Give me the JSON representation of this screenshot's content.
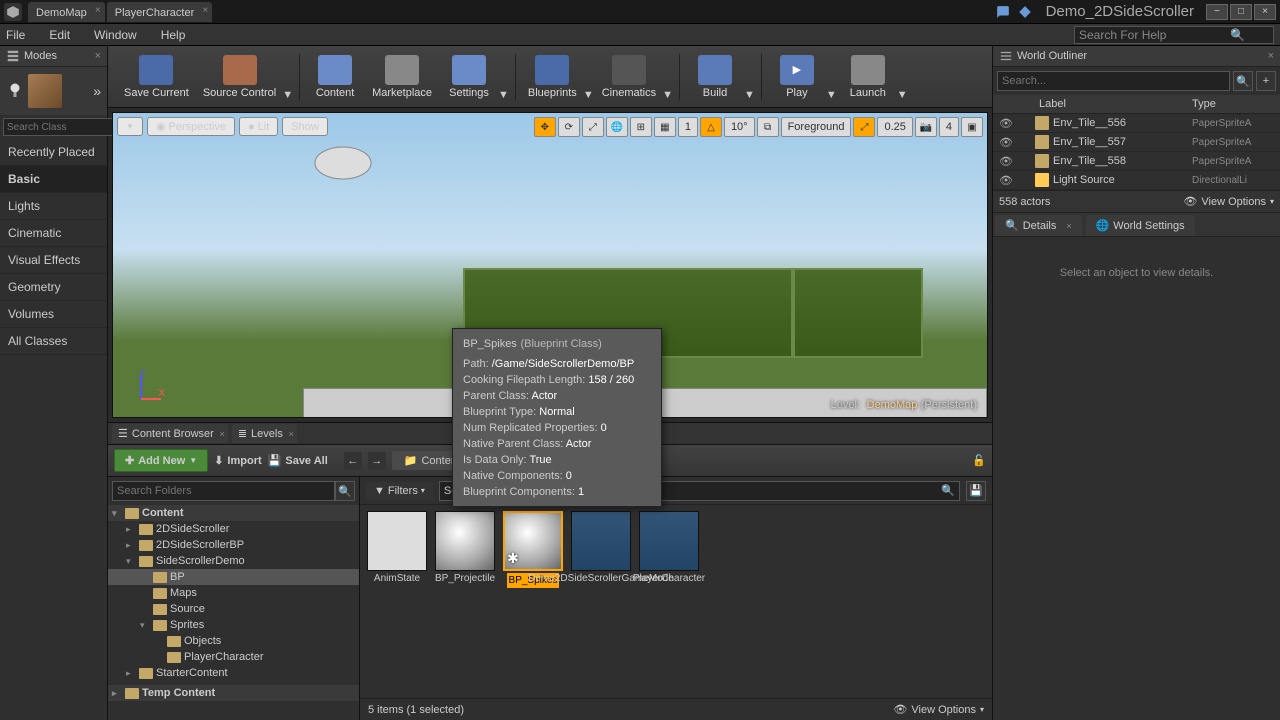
{
  "titlebar": {
    "tabs": [
      {
        "label": "DemoMap"
      },
      {
        "label": "PlayerCharacter"
      }
    ],
    "project": "Demo_2DSideScroller"
  },
  "menubar": {
    "items": [
      "File",
      "Edit",
      "Window",
      "Help"
    ],
    "search_placeholder": "Search For Help"
  },
  "modes": {
    "title": "Modes",
    "search_placeholder": "Search Class",
    "categories": [
      "Recently Placed",
      "Basic",
      "Lights",
      "Cinematic",
      "Visual Effects",
      "Geometry",
      "Volumes",
      "All Classes"
    ],
    "active_index": 1
  },
  "toolbar": {
    "buttons": [
      "Save Current",
      "Source Control",
      "Content",
      "Marketplace",
      "Settings",
      "Blueprints",
      "Cinematics",
      "Build",
      "Play",
      "Launch"
    ]
  },
  "viewport": {
    "perspective": "Perspective",
    "lit": "Lit",
    "show": "Show",
    "snap_grid": "1",
    "snap_angle": "10°",
    "layer": "Foreground",
    "cam_speed": "0.25",
    "scalability": "4",
    "level_label": "Level:",
    "level_name": "DemoMap",
    "level_mode": "(Persistent)",
    "axis_z": "Z",
    "axis_x": "X"
  },
  "tooltip": {
    "name": "BP_Spikes",
    "class": "(Blueprint Class)",
    "rows": [
      {
        "label": "Path:",
        "value": "/Game/SideScrollerDemo/BP"
      },
      {
        "label": "Cooking Filepath Length:",
        "value": "158 / 260"
      },
      {
        "label": "Parent Class:",
        "value": "Actor"
      },
      {
        "label": "Blueprint Type:",
        "value": "Normal"
      },
      {
        "label": "Num Replicated Properties:",
        "value": "0"
      },
      {
        "label": "Native Parent Class:",
        "value": "Actor"
      },
      {
        "label": "Is Data Only:",
        "value": "True"
      },
      {
        "label": "Native Components:",
        "value": "0"
      },
      {
        "label": "Blueprint Components:",
        "value": "1"
      }
    ]
  },
  "bottom_tabs": {
    "tabs": [
      "Content Browser",
      "Levels"
    ]
  },
  "content_browser": {
    "add_new": "Add New",
    "import": "Import",
    "save_all": "Save All",
    "path_item": "Content",
    "tree_search_placeholder": "Search Folders",
    "tree": {
      "root": "Content",
      "items": [
        {
          "name": "2DSideScroller",
          "indent": 1,
          "expanded": false
        },
        {
          "name": "2DSideScrollerBP",
          "indent": 1,
          "expanded": false
        },
        {
          "name": "SideScrollerDemo",
          "indent": 1,
          "expanded": true
        },
        {
          "name": "BP",
          "indent": 2,
          "expanded": false,
          "selected": true
        },
        {
          "name": "Maps",
          "indent": 2,
          "expanded": false
        },
        {
          "name": "Source",
          "indent": 2,
          "expanded": false
        },
        {
          "name": "Sprites",
          "indent": 2,
          "expanded": true
        },
        {
          "name": "Objects",
          "indent": 3,
          "expanded": false
        },
        {
          "name": "PlayerCharacter",
          "indent": 3,
          "expanded": false
        },
        {
          "name": "StarterContent",
          "indent": 1,
          "expanded": false
        }
      ],
      "temp": "Temp Content"
    },
    "filters_label": "Filters",
    "search_value": "Search BP",
    "assets": [
      {
        "name": "AnimState",
        "type": "anim"
      },
      {
        "name": "BP_Projectile",
        "type": "bp"
      },
      {
        "name": "BP_Spikes",
        "type": "bp",
        "selected": true
      },
      {
        "name": "Demo2DSideScrollerGameMode",
        "type": "gm"
      },
      {
        "name": "PlayerCharacter",
        "type": "gm"
      }
    ],
    "status": "5 items (1 selected)",
    "view_options": "View Options"
  },
  "outliner": {
    "title": "World Outliner",
    "search_placeholder": "Search...",
    "columns": {
      "label": "Label",
      "type": "Type"
    },
    "rows": [
      {
        "name": "Env_Tile__556",
        "type": "PaperSpriteA"
      },
      {
        "name": "Env_Tile__557",
        "type": "PaperSpriteA"
      },
      {
        "name": "Env_Tile__558",
        "type": "PaperSpriteA"
      },
      {
        "name": "Light Source",
        "type": "DirectionalLi"
      }
    ],
    "count": "558 actors",
    "view_options": "View Options"
  },
  "details": {
    "tabs": [
      "Details",
      "World Settings"
    ],
    "empty_message": "Select an object to view details."
  }
}
